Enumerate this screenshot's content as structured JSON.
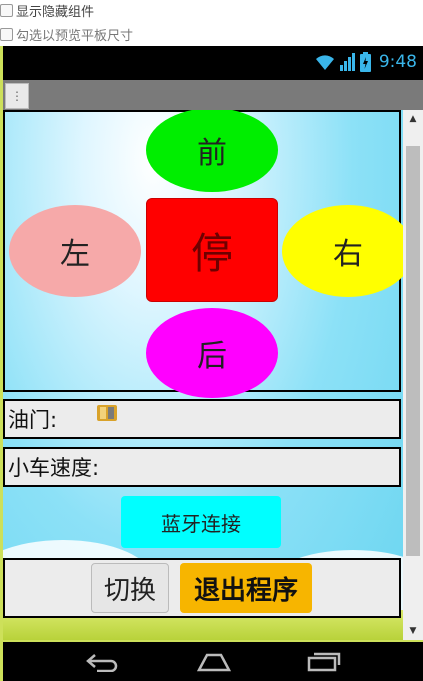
{
  "designer": {
    "show_hidden_label": "显示隐藏组件",
    "preview_tablet_label": "勾选以预览平板尺寸"
  },
  "statusbar": {
    "time": "9:48",
    "icons": [
      "wifi-icon",
      "signal-icon",
      "battery-charging-icon"
    ]
  },
  "titlebar": {
    "menu_icon": "overflow-menu-icon"
  },
  "controls": {
    "forward": "前",
    "left": "左",
    "stop": "停",
    "right": "右",
    "back": "后"
  },
  "throttle": {
    "label": "油门:"
  },
  "speed": {
    "label": "小车速度:"
  },
  "bluetooth": {
    "label": "蓝牙连接"
  },
  "bottom": {
    "switch_label": "切换",
    "exit_label": "退出程序"
  },
  "colors": {
    "forward": "#00ee00",
    "left": "#f6a9a9",
    "stop": "#ff0000",
    "right": "#ffff00",
    "back": "#ff00ff",
    "bluetooth": "#00ffff",
    "exit": "#f7b500"
  },
  "navbar": {
    "icons": [
      "back-nav-icon",
      "home-nav-icon",
      "recents-nav-icon"
    ]
  }
}
